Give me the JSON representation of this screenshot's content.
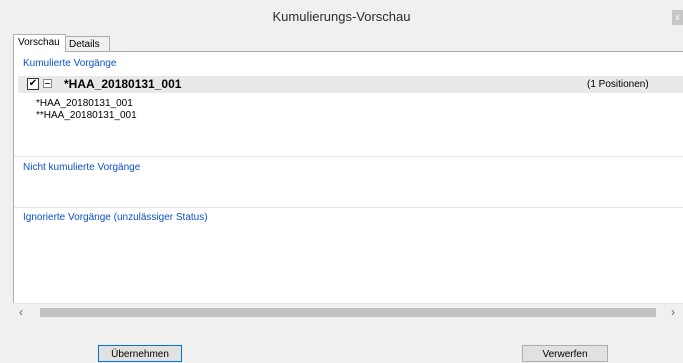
{
  "window": {
    "title": "Kumulierungs-Vorschau",
    "close_glyph": "x"
  },
  "tabs": [
    {
      "label": "Vorschau",
      "active": true
    },
    {
      "label": "Details",
      "active": false
    }
  ],
  "sections": {
    "kumuliert": {
      "header": "Kumulierte Vorgänge",
      "group": {
        "checked": true,
        "checkbox_glyph": "✔",
        "name": "*HAA_20180131_001",
        "positions": "(1 Positionen)",
        "children": [
          "*HAA_20180131_001",
          "**HAA_20180131_001"
        ]
      }
    },
    "nicht_kumuliert": {
      "header": "Nicht kumulierte Vorgänge"
    },
    "ignoriert": {
      "header": "Ignorierte Vorgänge (unzulässiger Status)"
    }
  },
  "scrollbar": {
    "left_arrow": "‹",
    "right_arrow": "›"
  },
  "buttons": {
    "accept": "Übernehmen",
    "discard": "Verwerfen"
  },
  "colors": {
    "section_header": "#0a50c8",
    "row_highlight": "#e9e9e9",
    "primary_border": "#0078d7"
  }
}
